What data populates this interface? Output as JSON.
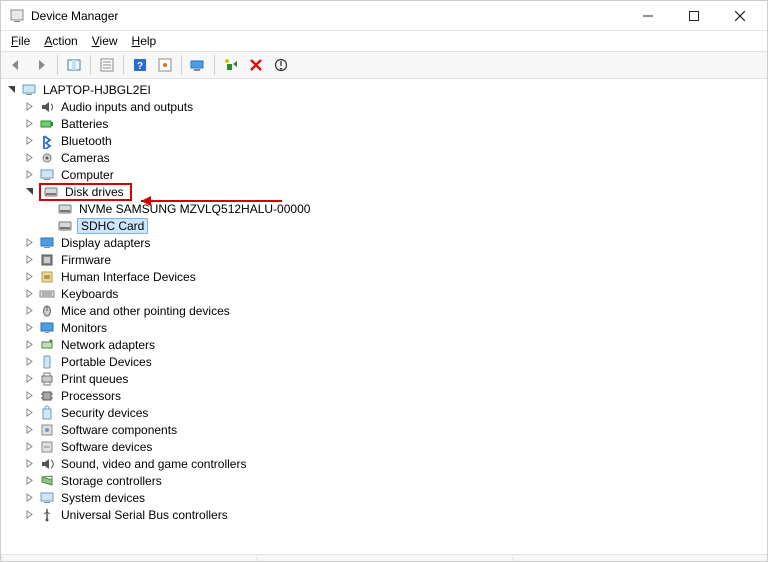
{
  "window": {
    "title": "Device Manager"
  },
  "menu": {
    "file": "File",
    "action": "Action",
    "view": "View",
    "help": "Help"
  },
  "root": {
    "label": "LAPTOP-HJBGL2EI"
  },
  "categories": [
    {
      "label": "Audio inputs and outputs",
      "icon": "audio"
    },
    {
      "label": "Batteries",
      "icon": "battery"
    },
    {
      "label": "Bluetooth",
      "icon": "bluetooth"
    },
    {
      "label": "Cameras",
      "icon": "camera"
    },
    {
      "label": "Computer",
      "icon": "computer"
    },
    {
      "label": "Disk drives",
      "icon": "disk",
      "expanded": true,
      "highlight": true,
      "children": [
        {
          "label": "NVMe SAMSUNG MZVLQ512HALU-00000",
          "icon": "disk"
        },
        {
          "label": "SDHC Card",
          "icon": "disk",
          "selected": true
        }
      ]
    },
    {
      "label": "Display adapters",
      "icon": "display"
    },
    {
      "label": "Firmware",
      "icon": "firmware"
    },
    {
      "label": "Human Interface Devices",
      "icon": "hid"
    },
    {
      "label": "Keyboards",
      "icon": "keyboard"
    },
    {
      "label": "Mice and other pointing devices",
      "icon": "mouse"
    },
    {
      "label": "Monitors",
      "icon": "monitor"
    },
    {
      "label": "Network adapters",
      "icon": "network"
    },
    {
      "label": "Portable Devices",
      "icon": "portable"
    },
    {
      "label": "Print queues",
      "icon": "printer"
    },
    {
      "label": "Processors",
      "icon": "cpu"
    },
    {
      "label": "Security devices",
      "icon": "security"
    },
    {
      "label": "Software components",
      "icon": "softcomp"
    },
    {
      "label": "Software devices",
      "icon": "softdev"
    },
    {
      "label": "Sound, video and game controllers",
      "icon": "sound"
    },
    {
      "label": "Storage controllers",
      "icon": "storage"
    },
    {
      "label": "System devices",
      "icon": "system"
    },
    {
      "label": "Universal Serial Bus controllers",
      "icon": "usb"
    }
  ]
}
